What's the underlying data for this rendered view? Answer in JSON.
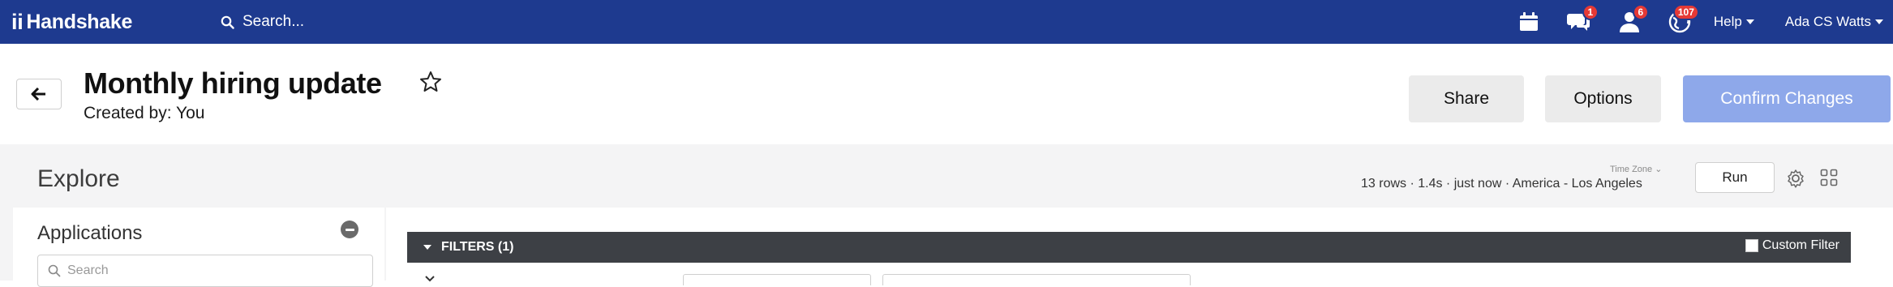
{
  "nav": {
    "brand": "Handshake",
    "search_placeholder": "Search...",
    "badges": {
      "messages": "1",
      "people": "6",
      "events": "107"
    },
    "help": "Help",
    "user": "Ada CS Watts"
  },
  "header": {
    "title": "Monthly hiring update",
    "created_by": "Created by: You",
    "share": "Share",
    "options": "Options",
    "confirm": "Confirm Changes"
  },
  "explore": {
    "title": "Explore",
    "status": "13 rows · 1.4s · just now · America - Los Angeles",
    "timezone_label": "Time Zone",
    "run": "Run"
  },
  "side": {
    "title": "Applications",
    "search_placeholder": "Search"
  },
  "filters": {
    "label": "FILTERS (1)",
    "custom_filter": "Custom Filter"
  },
  "colors": {
    "nav_bg": "#1e3a8f",
    "confirm_bg": "#8ea8ea",
    "badge": "#e53935",
    "filterbar_bg": "#3d4045"
  }
}
